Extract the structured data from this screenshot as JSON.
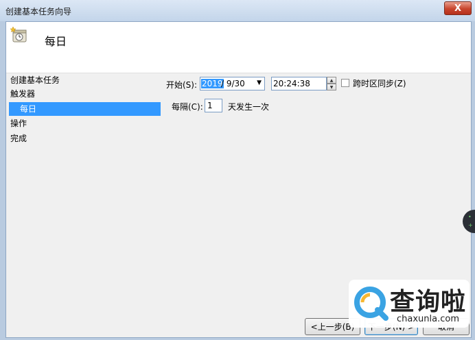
{
  "window": {
    "title": "创建基本任务向导",
    "close_symbol": "X"
  },
  "header": {
    "title": "每日",
    "icon": "task-scheduler-icon"
  },
  "sidebar": {
    "items": [
      {
        "label": "创建基本任务",
        "selected": false
      },
      {
        "label": "触发器",
        "selected": false
      },
      {
        "label": "每日",
        "selected": true
      },
      {
        "label": "操作",
        "selected": false
      },
      {
        "label": "完成",
        "selected": false
      }
    ]
  },
  "form": {
    "start_label": "开始(S):",
    "date_year": "2019",
    "date_rest": "/  9/30",
    "time_value": "20:24:38",
    "sync_tz_label": "跨时区同步(Z)",
    "sync_tz_checked": false,
    "interval_label": "每隔(C):",
    "interval_value": "1",
    "interval_suffix": "天发生一次"
  },
  "buttons": {
    "back": "<上一步(B)",
    "next": "下一步(N) >",
    "cancel": "取消"
  },
  "watermark": {
    "brand": "查询啦",
    "url": "chaxunla.com"
  },
  "colors": {
    "selection": "#3399ff",
    "client_bg": "#f0f0f0",
    "close": "#c8452d"
  }
}
